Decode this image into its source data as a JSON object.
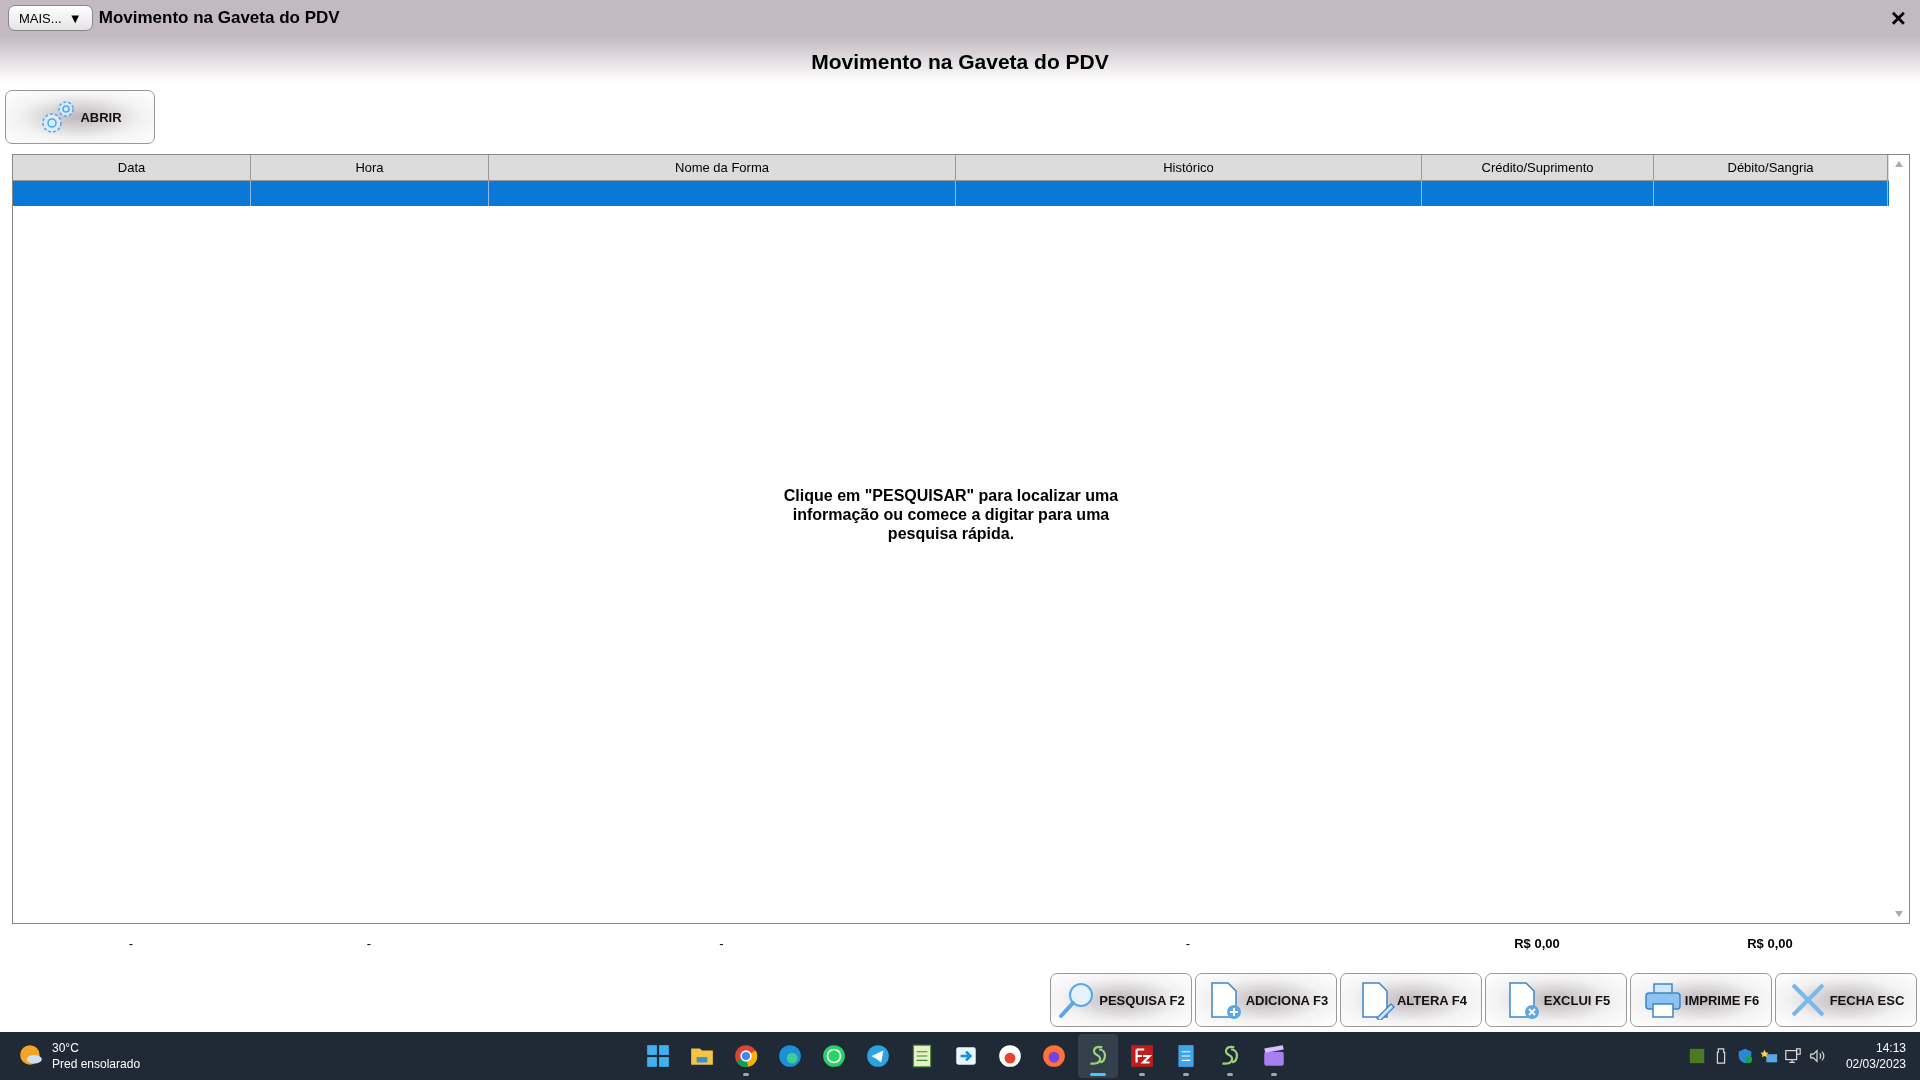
{
  "window": {
    "menu_button": "MAIS...",
    "menu_caret": "▼",
    "title": "Movimento na Gaveta do PDV",
    "close": "×"
  },
  "header": {
    "title": "Movimento na Gaveta do PDV"
  },
  "toolbar": {
    "open_button": "ABRIR"
  },
  "table": {
    "columns": [
      "Data",
      "Hora",
      "Nome da Forma",
      "Histórico",
      "Crédito/Suprimento",
      "Débito/Sangria"
    ],
    "rows": [
      {
        "selected": true
      }
    ],
    "empty_message": "Clique em \"PESQUISAR\" para localizar uma informação ou comece a digitar para uma pesquisa rápida."
  },
  "totals": [
    "-",
    "-",
    "-",
    "-",
    "R$ 0,00",
    "R$ 0,00"
  ],
  "actions": [
    {
      "kind": "search",
      "label": "PESQUISA F2"
    },
    {
      "kind": "add",
      "label": "ADICIONA F3"
    },
    {
      "kind": "edit",
      "label": "ALTERA F4"
    },
    {
      "kind": "delete",
      "label": "EXCLUI F5"
    },
    {
      "kind": "print",
      "label": "IMPRIME F6"
    },
    {
      "kind": "close",
      "label": "FECHA ESC"
    }
  ],
  "taskbar": {
    "weather": {
      "temperature": "30°C",
      "condition": "Pred ensolarado"
    },
    "apps": [
      {
        "kind": "start",
        "running": false,
        "selected": false
      },
      {
        "kind": "folder",
        "running": false,
        "selected": false
      },
      {
        "kind": "chrome",
        "running": true,
        "selected": false
      },
      {
        "kind": "edge",
        "running": false,
        "selected": false
      },
      {
        "kind": "whatsapp",
        "running": false,
        "selected": false
      },
      {
        "kind": "telegram",
        "running": false,
        "selected": false
      },
      {
        "kind": "sheet",
        "running": false,
        "selected": false
      },
      {
        "kind": "arrow",
        "running": false,
        "selected": false
      },
      {
        "kind": "bird",
        "running": false,
        "selected": false
      },
      {
        "kind": "firefox",
        "running": false,
        "selected": false
      },
      {
        "kind": "sg",
        "running": true,
        "selected": true
      },
      {
        "kind": "filezilla",
        "running": true,
        "selected": false
      },
      {
        "kind": "notepad",
        "running": true,
        "selected": false
      },
      {
        "kind": "sg",
        "running": true,
        "selected": false
      },
      {
        "kind": "clapper",
        "running": true,
        "selected": false
      }
    ],
    "time": "14:13",
    "date": "02/03/2023"
  }
}
